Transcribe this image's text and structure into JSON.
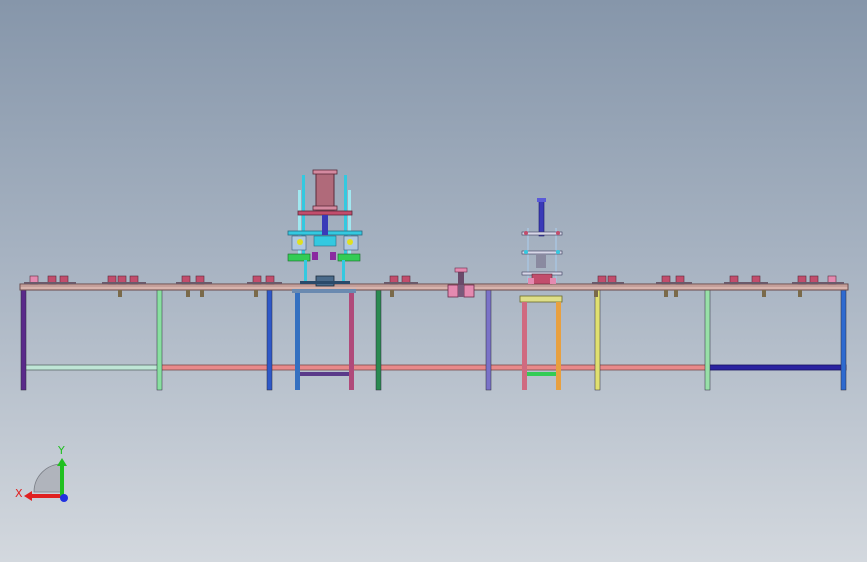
{
  "viewport": {
    "name": "cad-graphics-area",
    "background_top": "#8696aa",
    "background_bottom": "#d3d8de"
  },
  "model": {
    "assembly": "production-line-table",
    "colors": {
      "tabletop": "#d8b4ad",
      "tabletop_edge": "#6a4a4a",
      "stretcher_main": "#e8898a",
      "stretcher_left": "#bfe6d6",
      "stretcher_right": "#2a22a0",
      "cylinder_body": "#b06a7a",
      "green_block": "#33cc55",
      "cyan_frame": "#33c9e0",
      "blue_rod": "#3a3ab8",
      "yellow_plate": "#dede88",
      "fixture_red": "#c24d6c",
      "fixture_pink": "#e48ab0"
    },
    "legs": [
      {
        "color": "#5a2a8a"
      },
      {
        "color": "#88e0a0"
      },
      {
        "color": "#2e58c8"
      },
      {
        "color": "#3470c0"
      },
      {
        "color": "#b04a7a"
      },
      {
        "color": "#2a8a50"
      },
      {
        "color": "#7a72c8"
      },
      {
        "color": "#d06a80"
      },
      {
        "color": "#e8a040"
      },
      {
        "color": "#e0e070"
      },
      {
        "color": "#98e0a8"
      },
      {
        "color": "#2e6ad0"
      }
    ]
  },
  "triad": {
    "x_label": "X",
    "y_label": "Y",
    "x_color": "#e02020",
    "y_color": "#20c020",
    "z_color": "#2030e0"
  }
}
